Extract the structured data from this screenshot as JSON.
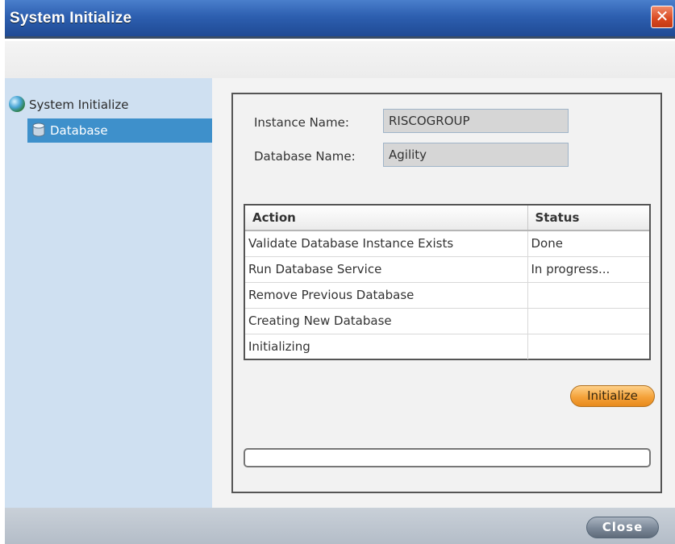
{
  "window": {
    "title": "System Initialize",
    "close_glyph": "✕"
  },
  "sidebar": {
    "root": {
      "label": "System Initialize",
      "icon": "globe-icon"
    },
    "items": [
      {
        "label": "Database",
        "icon": "database-icon",
        "selected": true
      }
    ]
  },
  "form": {
    "instance_label": "Instance Name:",
    "instance_value": "RISCOGROUP",
    "database_label": "Database Name:",
    "database_value": "Agility"
  },
  "table": {
    "columns": [
      "Action",
      "Status"
    ],
    "rows": [
      {
        "action": "Validate Database Instance Exists",
        "status": "Done"
      },
      {
        "action": "Run Database Service",
        "status": "In progress..."
      },
      {
        "action": "Remove Previous Database",
        "status": ""
      },
      {
        "action": "Creating New Database",
        "status": ""
      },
      {
        "action": "Initializing",
        "status": ""
      }
    ]
  },
  "buttons": {
    "initialize": "Initialize",
    "close": "Close"
  },
  "progress": {
    "value": 0
  },
  "colors": {
    "title_bar": "#2d5fb0",
    "sidebar_bg": "#cfe0f1",
    "selected_item": "#3e90cb",
    "initialize_button": "#f4a23a",
    "close_button": "#7a8797"
  }
}
